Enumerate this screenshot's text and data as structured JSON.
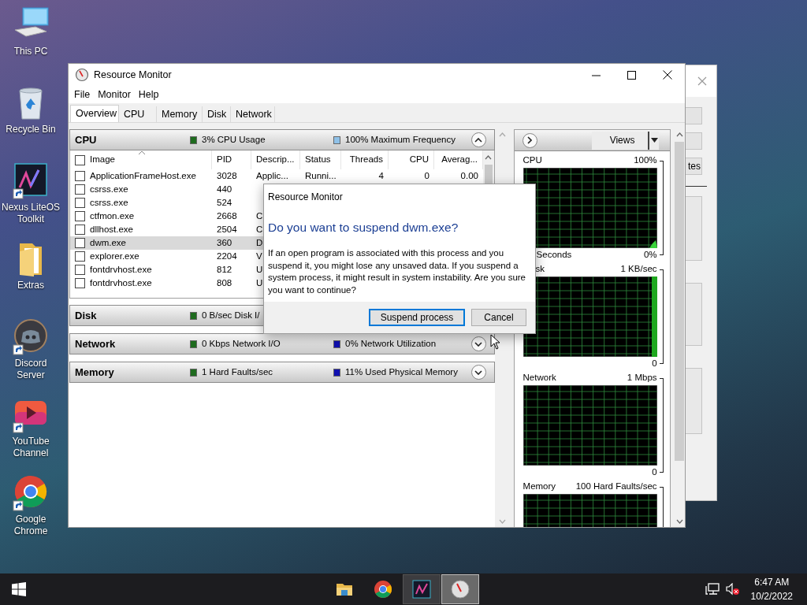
{
  "desktop_icons": [
    {
      "label": "This PC",
      "kind": "pc",
      "shortcut": false
    },
    {
      "label": "Recycle Bin",
      "kind": "recycle",
      "shortcut": false
    },
    {
      "label": "Nexus LiteOS Toolkit",
      "kind": "nexus",
      "shortcut": true
    },
    {
      "label": "Extras",
      "kind": "folder",
      "shortcut": false
    },
    {
      "label": "Discord Server",
      "kind": "discord",
      "shortcut": true
    },
    {
      "label": "YouTube Channel",
      "kind": "youtube",
      "shortcut": true
    },
    {
      "label": "Google Chrome",
      "kind": "chrome",
      "shortcut": true
    }
  ],
  "background_window": {
    "button_text": "tes"
  },
  "window": {
    "title": "Resource Monitor",
    "menu": [
      "File",
      "Monitor",
      "Help"
    ],
    "tabs": [
      {
        "label": "Overview",
        "selected": true
      },
      {
        "label": "CPU",
        "selected": false
      },
      {
        "label": "Memory",
        "selected": false
      },
      {
        "label": "Disk",
        "selected": false
      },
      {
        "label": "Network",
        "selected": false
      }
    ]
  },
  "cpu_section": {
    "title": "CPU",
    "expanded": true,
    "stats": [
      {
        "text": "3% CPU Usage",
        "color": "#1e6b1e"
      },
      {
        "text": "100% Maximum Frequency",
        "color": "#8fc1e8"
      }
    ],
    "table": {
      "columns": [
        "Image",
        "PID",
        "Descrip...",
        "Status",
        "Threads",
        "CPU",
        "Averag..."
      ],
      "rows": [
        {
          "checked": false,
          "selected": false,
          "cells": [
            "ApplicationFrameHost.exe",
            "3028",
            "Applic...",
            "Runni...",
            "4",
            "0",
            "0.00"
          ]
        },
        {
          "checked": false,
          "selected": false,
          "cells": [
            "csrss.exe",
            "440"
          ]
        },
        {
          "checked": false,
          "selected": false,
          "cells": [
            "csrss.exe",
            "524"
          ]
        },
        {
          "checked": false,
          "selected": false,
          "cells": [
            "ctfmon.exe",
            "2668",
            "C"
          ]
        },
        {
          "checked": false,
          "selected": false,
          "cells": [
            "dllhost.exe",
            "2504",
            "C"
          ]
        },
        {
          "checked": false,
          "selected": true,
          "cells": [
            "dwm.exe",
            "360",
            "D"
          ]
        },
        {
          "checked": false,
          "selected": false,
          "cells": [
            "explorer.exe",
            "2204",
            "V"
          ]
        },
        {
          "checked": false,
          "selected": false,
          "cells": [
            "fontdrvhost.exe",
            "812",
            "U"
          ]
        },
        {
          "checked": false,
          "selected": false,
          "cells": [
            "fontdrvhost.exe",
            "808",
            "U"
          ]
        }
      ],
      "select_all_checked": false
    }
  },
  "sections": [
    {
      "title": "Disk",
      "stats": [
        {
          "text": "0 B/sec Disk I/",
          "color": "#1e6b1e"
        }
      ]
    },
    {
      "title": "Network",
      "expanded": false,
      "stats": [
        {
          "text": "0 Kbps Network I/O",
          "color": "#1e6b1e"
        },
        {
          "text": "0% Network Utilization",
          "color": "#1010b0"
        }
      ]
    },
    {
      "title": "Memory",
      "expanded": false,
      "stats": [
        {
          "text": "1 Hard Faults/sec",
          "color": "#1e6b1e"
        },
        {
          "text": "11% Used Physical Memory",
          "color": "#1010b0"
        }
      ]
    }
  ],
  "graphs_pane": {
    "views_button": "Views",
    "graphs": [
      {
        "title": "CPU",
        "max": "100%",
        "footer": "Seconds",
        "min": "0%",
        "kind": "spike"
      },
      {
        "title": "sk",
        "max": "1 KB/sec",
        "min": "0",
        "kind": "bar"
      },
      {
        "title": "Network",
        "max": "1 Mbps",
        "min": "0",
        "kind": "flat"
      },
      {
        "title": "Memory",
        "max": "100 Hard Faults/sec",
        "kind": "flat"
      }
    ]
  },
  "dialog": {
    "title": "Resource Monitor",
    "heading": "Do you want to suspend dwm.exe?",
    "message": "If an open program is associated with this process and you suspend it, you might lose any unsaved data. If you suspend a system process, it might result in system instability. Are you sure you want to continue?",
    "buttons": [
      {
        "label": "Suspend process",
        "default": true
      },
      {
        "label": "Cancel",
        "default": false
      }
    ]
  },
  "taskbar": {
    "apps": [
      {
        "kind": "folder",
        "open": false,
        "focused": false
      },
      {
        "kind": "chrome",
        "open": false,
        "focused": false
      },
      {
        "kind": "nexus",
        "open": true,
        "focused": false
      },
      {
        "kind": "resmon",
        "open": true,
        "focused": true
      }
    ],
    "time": "6:47 AM",
    "date": "10/2/2022"
  }
}
